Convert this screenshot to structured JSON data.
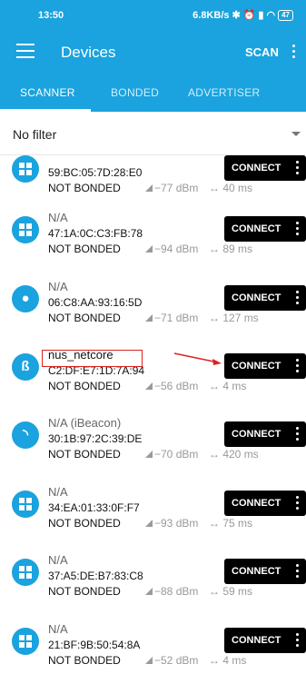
{
  "status": {
    "time": "13:50",
    "speed": "6.8KB/s",
    "battery": "47",
    "icons": [
      "bluetooth-icon",
      "alarm-icon",
      "clock-icon",
      "signal-icon",
      "wifi-icon"
    ]
  },
  "toolbar": {
    "title": "Devices",
    "scan": "SCAN"
  },
  "tabs": [
    "SCANNER",
    "BONDED",
    "ADVERTISER"
  ],
  "filter": {
    "value": "No filter"
  },
  "devices": [
    {
      "name": "",
      "address": "59:BC:05:7D:28:E0",
      "bond": "NOT BONDED",
      "rssi": "−77 dBm",
      "interval": "↔ 40 ms",
      "icon": "windows-icon",
      "button": "CONNECT"
    },
    {
      "name": "N/A",
      "address": "47:1A:0C:C3:FB:78",
      "bond": "NOT BONDED",
      "rssi": "−94 dBm",
      "interval": "↔ 89 ms",
      "icon": "windows-icon",
      "button": "CONNECT"
    },
    {
      "name": "N/A",
      "address": "06:C8:AA:93:16:5D",
      "bond": "NOT BONDED",
      "rssi": "−71 dBm",
      "interval": "↔ 127 ms",
      "icon": "apple-icon",
      "button": "CONNECT"
    },
    {
      "name": "nus_netcore",
      "address": "C2:DF:E7:1D:7A:94",
      "bond": "NOT BONDED",
      "rssi": "−56 dBm",
      "interval": "↔ 4 ms",
      "icon": "bluetooth-icon",
      "button": "CONNECT"
    },
    {
      "name": "N/A  (iBeacon)",
      "address": "30:1B:97:2C:39:DE",
      "bond": "NOT BONDED",
      "rssi": "−70 dBm",
      "interval": "↔ 420 ms",
      "icon": "beacon-icon",
      "button": "CONNECT"
    },
    {
      "name": "N/A",
      "address": "34:EA:01:33:0F:F7",
      "bond": "NOT BONDED",
      "rssi": "−93 dBm",
      "interval": "↔ 75 ms",
      "icon": "windows-icon",
      "button": "CONNECT"
    },
    {
      "name": "N/A",
      "address": "37:A5:DE:B7:83:C8",
      "bond": "NOT BONDED",
      "rssi": "−88 dBm",
      "interval": "↔ 59 ms",
      "icon": "windows-icon",
      "button": "CONNECT"
    },
    {
      "name": "N/A",
      "address": "21:BF:9B:50:54:8A",
      "bond": "NOT BONDED",
      "rssi": "−52 dBm",
      "interval": "↔ 4 ms",
      "icon": "windows-icon",
      "button": "CONNECT"
    }
  ],
  "colors": {
    "primary": "#1aa3de",
    "highlight": "#e02020",
    "button": "#000000"
  }
}
